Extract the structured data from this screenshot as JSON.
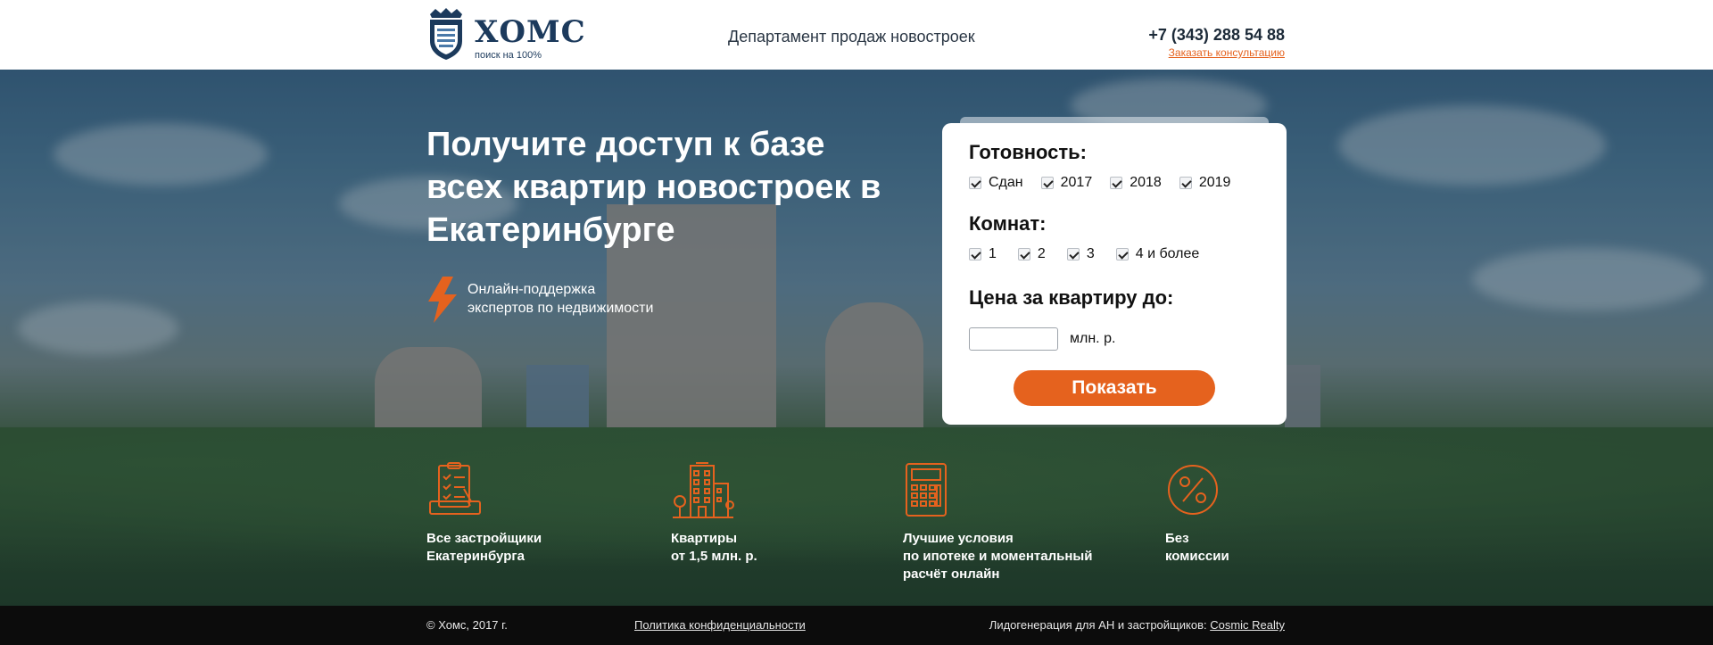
{
  "header": {
    "logo_name": "ХОМС",
    "logo_tagline": "поиск на 100%",
    "department": "Департамент продаж новостроек",
    "phone": "+7 (343) 288 54 88",
    "consult_link": "Заказать консультацию"
  },
  "hero": {
    "headline": "Получите доступ к базе всех квартир новостроек в Екатеринбурге",
    "support_line1": "Онлайн-поддержка",
    "support_line2": "экспертов по недвижимости"
  },
  "form": {
    "readiness_title": "Готовность:",
    "readiness_options": [
      "Сдан",
      "2017",
      "2018",
      "2019"
    ],
    "rooms_title": "Комнат:",
    "rooms_options": [
      "1",
      "2",
      "3",
      "4 и более"
    ],
    "price_title": "Цена за квартиру до:",
    "price_value": "",
    "price_unit": "млн. р.",
    "submit_label": "Показать"
  },
  "features": [
    {
      "line1": "Все застройщики",
      "line2": "Екатеринбурга",
      "line3": "",
      "icon": "checklist-icon"
    },
    {
      "line1": "Квартиры",
      "line2": "от 1,5 млн. р.",
      "line3": "",
      "icon": "building-icon"
    },
    {
      "line1": "Лучшие условия",
      "line2": "по ипотеке и моментальный",
      "line3": "расчёт онлайн",
      "icon": "calculator-icon"
    },
    {
      "line1": "Без",
      "line2": "комиссии",
      "line3": "",
      "icon": "percent-icon"
    }
  ],
  "footer": {
    "copyright": "© Хомс, 2017 г.",
    "policy_link": "Политика конфиденциальности",
    "leadgen_text": "Лидогенерация для АН и застройщиков: ",
    "leadgen_link": "Cosmic Realty"
  },
  "colors": {
    "accent": "#e5621e",
    "brand_dark": "#1c3a5c",
    "footer_bg": "#0c0c0c"
  }
}
